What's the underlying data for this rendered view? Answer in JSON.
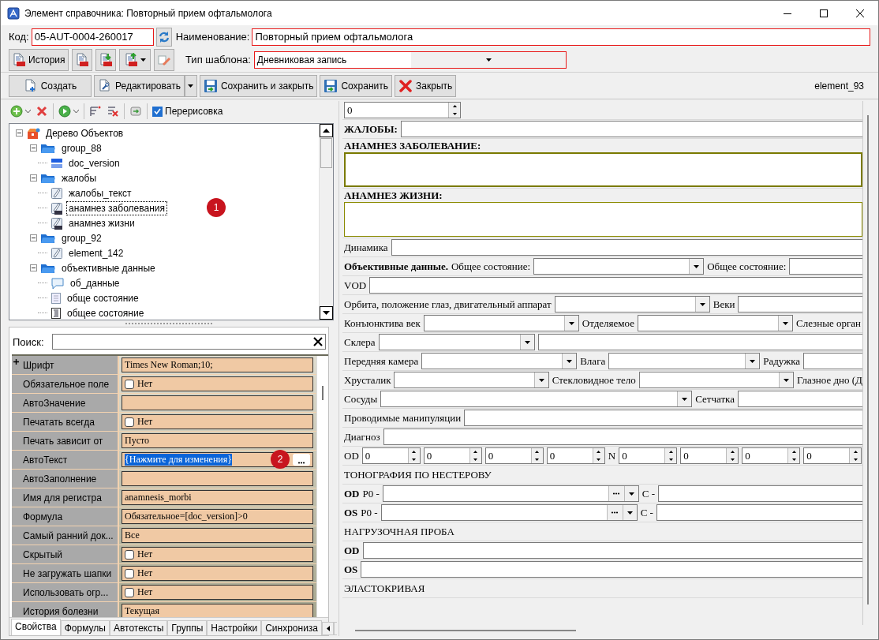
{
  "window": {
    "title": "Элемент справочника: Повторный прием офтальмолога"
  },
  "header": {
    "code_label": "Код:",
    "code_value": "05-AUT-0004-260017",
    "name_label": "Наименование:",
    "name_value": "Повторный прием офтальмолога",
    "history_label": "История",
    "template_label": "Тип шаблона:",
    "template_value": "Дневниковая запись"
  },
  "toolbar": {
    "buttons": [
      {
        "kind": "create",
        "label": "Создать",
        "dropdown": false
      },
      {
        "kind": "edit",
        "label": "Редактировать",
        "dropdown": true
      },
      {
        "kind": "save",
        "label": "Сохранить и закрыть",
        "dropdown": false
      },
      {
        "kind": "save",
        "label": "Сохранить",
        "dropdown": false
      },
      {
        "kind": "close",
        "label": "Закрыть",
        "dropdown": false
      }
    ],
    "element_name": "element_93"
  },
  "tree_toolbar": {
    "redraw_label": "Перерисовка",
    "redraw_checked": true
  },
  "tree": {
    "items": [
      {
        "kind": "root",
        "label": "Дерево Объектов",
        "expanded": true,
        "selected": false,
        "children": [
          {
            "kind": "group",
            "label": "group_88",
            "expanded": true,
            "selected": false,
            "children": [
              {
                "kind": "number",
                "label": "doc_version",
                "selected": false
              }
            ]
          },
          {
            "kind": "group",
            "label": "жалобы",
            "expanded": true,
            "selected": false,
            "children": [
              {
                "kind": "text",
                "label": "жалобы_текст",
                "selected": false
              },
              {
                "kind": "rtf",
                "label": "анамнез заболевания",
                "selected": true,
                "badge": "1"
              },
              {
                "kind": "rtf",
                "label": "анамнез жизни",
                "selected": false
              }
            ]
          },
          {
            "kind": "group",
            "label": "group_92",
            "expanded": true,
            "selected": false,
            "children": [
              {
                "kind": "text",
                "label": "element_142",
                "selected": false
              }
            ]
          },
          {
            "kind": "group",
            "label": "объективные данные",
            "expanded": true,
            "selected": false,
            "children": [
              {
                "kind": "comment",
                "label": "об_данные",
                "selected": false
              },
              {
                "kind": "document",
                "label": "обще состояние",
                "selected": false
              },
              {
                "kind": "list",
                "label": "общее состояние",
                "selected": false
              }
            ]
          }
        ]
      }
    ]
  },
  "properties": {
    "search_label": "Поиск:",
    "rows": [
      {
        "name": "Шрифт",
        "kind": "text",
        "value": "Times New Roman;10;",
        "expandable": true,
        "selected": false
      },
      {
        "name": "Обязательное поле",
        "kind": "checkbox",
        "checked": false,
        "value": "Нет",
        "selected": false
      },
      {
        "name": "АвтоЗначение",
        "kind": "text",
        "selected": false
      },
      {
        "name": "Печатать всегда",
        "kind": "checkbox",
        "checked": false,
        "value": "Нет",
        "selected": false
      },
      {
        "name": "Печать зависит от",
        "kind": "text",
        "value": "Пусто",
        "selected": false
      },
      {
        "name": "АвтоТекст",
        "kind": "button",
        "value": "{Нажмите для изменения}",
        "selected": true,
        "badge": "2"
      },
      {
        "name": "АвтоЗаполнение",
        "kind": "text",
        "selected": false
      },
      {
        "name": "Имя для регистра",
        "kind": "text",
        "value": "anamnesis_morbi",
        "selected": false
      },
      {
        "name": "Формула",
        "kind": "text",
        "value": "Обязательное=[doc_version]>0",
        "selected": false
      },
      {
        "name": "Самый ранний док...",
        "kind": "text",
        "value": "Все",
        "selected": false
      },
      {
        "name": "Скрытый",
        "kind": "checkbox",
        "checked": false,
        "value": "Нет",
        "selected": false
      },
      {
        "name": "Не загружать шапки",
        "kind": "checkbox",
        "checked": false,
        "value": "Нет",
        "selected": false
      },
      {
        "name": "Использовать огр...",
        "kind": "checkbox",
        "checked": false,
        "value": "Нет",
        "selected": false
      },
      {
        "name": "История болезни",
        "kind": "text",
        "value": "Текущая",
        "selected": false
      }
    ],
    "tabs": [
      {
        "label": "Свойства",
        "selected": true
      },
      {
        "label": "Формулы",
        "selected": false
      },
      {
        "label": "Автотексты",
        "selected": false
      },
      {
        "label": "Группы",
        "selected": false
      },
      {
        "label": "Настройки",
        "selected": false
      },
      {
        "label": "Синхрониза",
        "selected": false
      }
    ]
  },
  "form": {
    "rows": [
      {
        "items": [
          {
            "kind": "spin",
            "value": "0"
          }
        ]
      },
      {
        "items": [
          {
            "kind": "bold",
            "text": "ЖАЛОБЫ:"
          },
          {
            "kind": "field"
          }
        ]
      },
      {
        "items": [
          {
            "kind": "bold",
            "text": "АНАМНЕЗ ЗАБОЛЕВАНИЕ:"
          },
          {
            "kind": "memo",
            "focused": true
          }
        ]
      },
      {
        "items": [
          {
            "kind": "bold",
            "text": "АНАМНЕЗ ЖИЗНИ:"
          },
          {
            "kind": "memo",
            "focused": false
          }
        ]
      },
      {
        "items": [
          {
            "kind": "label",
            "text": "Динамика"
          },
          {
            "kind": "field"
          }
        ]
      },
      {
        "items": [
          {
            "kind": "bold",
            "text": "Объективные данные."
          },
          {
            "kind": "label",
            "text": "Общее состояние:"
          },
          {
            "kind": "combo"
          },
          {
            "kind": "label",
            "text": "Общее состояние:"
          },
          {
            "kind": "field"
          }
        ]
      },
      {
        "items": [
          {
            "kind": "label",
            "text": "VOD"
          },
          {
            "kind": "field"
          }
        ]
      },
      {
        "items": [
          {
            "kind": "label",
            "text": "Орбита, положение глаз, двигательный аппарат"
          },
          {
            "kind": "combo"
          },
          {
            "kind": "label",
            "text": "Веки"
          },
          {
            "kind": "field"
          }
        ]
      },
      {
        "items": [
          {
            "kind": "label",
            "text": "Конъюнктива век"
          },
          {
            "kind": "combo"
          },
          {
            "kind": "label",
            "text": "Отделяемое"
          },
          {
            "kind": "combo"
          },
          {
            "kind": "label",
            "text": "Слезные орган"
          }
        ]
      },
      {
        "items": [
          {
            "kind": "label",
            "text": "Склера"
          },
          {
            "kind": "combo"
          },
          {
            "kind": "field"
          }
        ]
      },
      {
        "items": [
          {
            "kind": "label",
            "text": "Передняя камера"
          },
          {
            "kind": "combo"
          },
          {
            "kind": "label",
            "text": "Влага"
          },
          {
            "kind": "combo"
          },
          {
            "kind": "label",
            "text": "Радужка"
          },
          {
            "kind": "field"
          }
        ]
      },
      {
        "items": [
          {
            "kind": "label",
            "text": "Хрусталик"
          },
          {
            "kind": "combo"
          },
          {
            "kind": "label",
            "text": "Стекловидное тело"
          },
          {
            "kind": "combo"
          },
          {
            "kind": "label",
            "text": "Глазное дно (Д"
          }
        ]
      },
      {
        "items": [
          {
            "kind": "label",
            "text": "Сосуды"
          },
          {
            "kind": "combo"
          },
          {
            "kind": "label",
            "text": "Сетчатка"
          },
          {
            "kind": "field"
          }
        ]
      },
      {
        "items": [
          {
            "kind": "label",
            "text": "Проводимые манипуляции"
          },
          {
            "kind": "field"
          }
        ]
      },
      {
        "items": [
          {
            "kind": "label",
            "text": "Диагноз"
          },
          {
            "kind": "field"
          }
        ]
      },
      {
        "items": [
          {
            "kind": "label",
            "text": "OD"
          },
          {
            "kind": "spin",
            "value": "0"
          },
          {
            "kind": "spin",
            "value": "0"
          },
          {
            "kind": "spin",
            "value": "0"
          },
          {
            "kind": "spin",
            "value": "0"
          },
          {
            "kind": "label",
            "text": "N"
          },
          {
            "kind": "spin",
            "value": "0"
          },
          {
            "kind": "spin",
            "value": "0"
          },
          {
            "kind": "spin",
            "value": "0"
          },
          {
            "kind": "spin",
            "value": "0"
          }
        ]
      },
      {
        "items": [
          {
            "kind": "label",
            "text": "ТОНОГРАФИЯ ПО НЕСТЕРОВУ"
          }
        ]
      },
      {
        "items": [
          {
            "kind": "bold",
            "text": "OD"
          },
          {
            "kind": "label",
            "text": "P0 -"
          },
          {
            "kind": "picker"
          },
          {
            "kind": "label",
            "text": "C -"
          },
          {
            "kind": "field"
          }
        ]
      },
      {
        "items": [
          {
            "kind": "bold",
            "text": "OS"
          },
          {
            "kind": "label",
            "text": "P0 -"
          },
          {
            "kind": "picker"
          },
          {
            "kind": "label",
            "text": "C -"
          },
          {
            "kind": "field"
          }
        ]
      },
      {
        "items": [
          {
            "kind": "label",
            "text": "НАГРУЗОЧНАЯ ПРОБА"
          }
        ]
      },
      {
        "items": [
          {
            "kind": "bold",
            "text": "OD"
          },
          {
            "kind": "field"
          }
        ]
      },
      {
        "items": [
          {
            "kind": "bold",
            "text": "OS"
          },
          {
            "kind": "field"
          }
        ]
      },
      {
        "items": [
          {
            "kind": "label",
            "text": "ЭЛАСТОКРИВАЯ"
          }
        ]
      }
    ]
  }
}
